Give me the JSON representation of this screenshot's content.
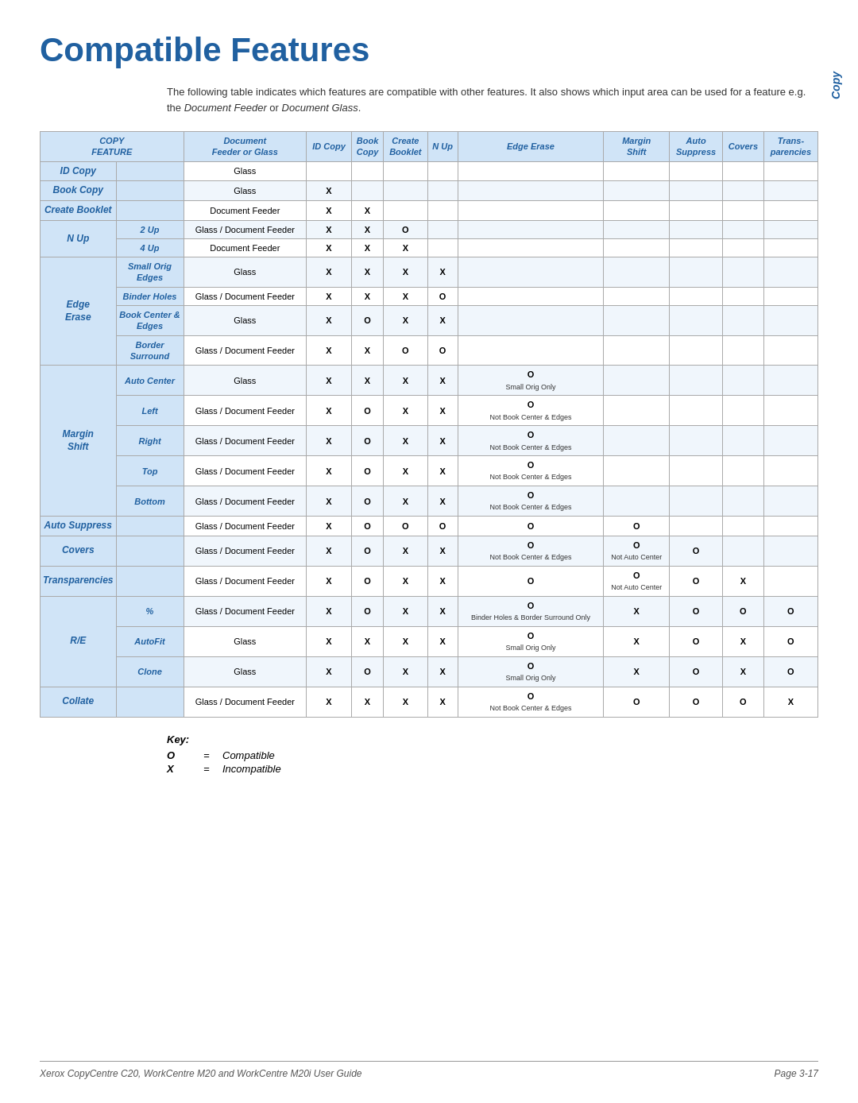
{
  "page": {
    "title": "Compatible Features",
    "side_label": "Copy",
    "intro": "The following table indicates which features are compatible with other features. It also shows which input area can be used for a feature e.g. the Document Feeder or Document Glass.",
    "footer_left": "Xerox CopyCentre C20, WorkCentre M20 and WorkCentre M20i User Guide",
    "footer_right": "Page 3-17"
  },
  "table": {
    "headers": [
      {
        "label": "COPY\nFEATURE",
        "sub": ""
      },
      {
        "label": "Document\nFeeder or Glass",
        "sub": ""
      },
      {
        "label": "ID Copy",
        "sub": ""
      },
      {
        "label": "Book\nCopy",
        "sub": ""
      },
      {
        "label": "Create\nBooklet",
        "sub": ""
      },
      {
        "label": "N Up",
        "sub": ""
      },
      {
        "label": "Edge Erase",
        "sub": ""
      },
      {
        "label": "Margin\nShift",
        "sub": ""
      },
      {
        "label": "Auto\nSuppress",
        "sub": ""
      },
      {
        "label": "Covers",
        "sub": ""
      },
      {
        "label": "Trans-\nparencies",
        "sub": ""
      }
    ],
    "rows": [
      {
        "feature": "ID Copy",
        "subfeature": "",
        "doc": "Glass",
        "id_copy": "",
        "book_copy": "",
        "create_booklet": "",
        "n_up": "",
        "edge_erase": "",
        "margin_shift": "",
        "auto_suppress": "",
        "covers": "",
        "transparencies": "",
        "alt": false
      },
      {
        "feature": "Book Copy",
        "subfeature": "",
        "doc": "Glass",
        "id_copy": "X",
        "book_copy": "",
        "create_booklet": "",
        "n_up": "",
        "edge_erase": "",
        "margin_shift": "",
        "auto_suppress": "",
        "covers": "",
        "transparencies": "",
        "alt": true
      },
      {
        "feature": "Create Booklet",
        "subfeature": "",
        "doc": "Document Feeder",
        "id_copy": "X",
        "book_copy": "X",
        "create_booklet": "",
        "n_up": "",
        "edge_erase": "",
        "margin_shift": "",
        "auto_suppress": "",
        "covers": "",
        "transparencies": "",
        "alt": false
      },
      {
        "feature": "N Up",
        "subfeature": "2 Up",
        "doc": "Glass / Document Feeder",
        "id_copy": "X",
        "book_copy": "X",
        "create_booklet": "O",
        "n_up": "",
        "edge_erase": "",
        "margin_shift": "",
        "auto_suppress": "",
        "covers": "",
        "transparencies": "",
        "alt": true
      },
      {
        "feature": "",
        "subfeature": "4 Up",
        "doc": "Document Feeder",
        "id_copy": "X",
        "book_copy": "X",
        "create_booklet": "X",
        "n_up": "",
        "edge_erase": "",
        "margin_shift": "",
        "auto_suppress": "",
        "covers": "",
        "transparencies": "",
        "alt": false
      },
      {
        "feature": "Edge\nErase",
        "subfeature": "Small Orig Edges",
        "doc": "Glass",
        "id_copy": "X",
        "book_copy": "X",
        "create_booklet": "X",
        "n_up": "X",
        "edge_erase": "",
        "margin_shift": "",
        "auto_suppress": "",
        "covers": "",
        "transparencies": "",
        "alt": true
      },
      {
        "feature": "",
        "subfeature": "Binder Holes",
        "doc": "Glass / Document Feeder",
        "id_copy": "X",
        "book_copy": "X",
        "create_booklet": "X",
        "n_up": "O",
        "edge_erase": "",
        "margin_shift": "",
        "auto_suppress": "",
        "covers": "",
        "transparencies": "",
        "alt": false
      },
      {
        "feature": "",
        "subfeature": "Book Center & Edges",
        "doc": "Glass",
        "id_copy": "X",
        "book_copy": "O",
        "create_booklet": "X",
        "n_up": "X",
        "edge_erase": "",
        "margin_shift": "",
        "auto_suppress": "",
        "covers": "",
        "transparencies": "",
        "alt": true
      },
      {
        "feature": "",
        "subfeature": "Border Surround",
        "doc": "Glass / Document Feeder",
        "id_copy": "X",
        "book_copy": "X",
        "create_booklet": "O",
        "n_up": "O",
        "edge_erase": "",
        "margin_shift": "",
        "auto_suppress": "",
        "covers": "",
        "transparencies": "",
        "alt": false
      },
      {
        "feature": "Margin\nShift",
        "subfeature": "Auto Center",
        "doc": "Glass",
        "id_copy": "X",
        "book_copy": "X",
        "create_booklet": "X",
        "n_up": "X",
        "edge_erase": "O\nSmall Orig Only",
        "margin_shift": "",
        "auto_suppress": "",
        "covers": "",
        "transparencies": "",
        "alt": true
      },
      {
        "feature": "",
        "subfeature": "Left",
        "doc": "Glass / Document Feeder",
        "id_copy": "X",
        "book_copy": "O",
        "create_booklet": "X",
        "n_up": "X",
        "edge_erase": "O\nNot Book Center & Edges",
        "margin_shift": "",
        "auto_suppress": "",
        "covers": "",
        "transparencies": "",
        "alt": false
      },
      {
        "feature": "",
        "subfeature": "Right",
        "doc": "Glass / Document Feeder",
        "id_copy": "X",
        "book_copy": "O",
        "create_booklet": "X",
        "n_up": "X",
        "edge_erase": "O\nNot Book Center & Edges",
        "margin_shift": "",
        "auto_suppress": "",
        "covers": "",
        "transparencies": "",
        "alt": true
      },
      {
        "feature": "",
        "subfeature": "Top",
        "doc": "Glass / Document Feeder",
        "id_copy": "X",
        "book_copy": "O",
        "create_booklet": "X",
        "n_up": "X",
        "edge_erase": "O\nNot Book Center & Edges",
        "margin_shift": "",
        "auto_suppress": "",
        "covers": "",
        "transparencies": "",
        "alt": false
      },
      {
        "feature": "",
        "subfeature": "Bottom",
        "doc": "Glass / Document Feeder",
        "id_copy": "X",
        "book_copy": "O",
        "create_booklet": "X",
        "n_up": "X",
        "edge_erase": "O\nNot Book Center & Edges",
        "margin_shift": "",
        "auto_suppress": "",
        "covers": "",
        "transparencies": "",
        "alt": true
      },
      {
        "feature": "Auto Suppress",
        "subfeature": "",
        "doc": "Glass / Document Feeder",
        "id_copy": "X",
        "book_copy": "O",
        "create_booklet": "O",
        "n_up": "O",
        "edge_erase": "O",
        "margin_shift": "O",
        "auto_suppress": "",
        "covers": "",
        "transparencies": "",
        "alt": false
      },
      {
        "feature": "Covers",
        "subfeature": "",
        "doc": "Glass / Document Feeder",
        "id_copy": "X",
        "book_copy": "O",
        "create_booklet": "X",
        "n_up": "X",
        "edge_erase": "O\nNot Book Center & Edges",
        "margin_shift": "O\nNot Auto Center",
        "auto_suppress": "O",
        "covers": "",
        "transparencies": "",
        "alt": true
      },
      {
        "feature": "Transparencies",
        "subfeature": "",
        "doc": "Glass / Document Feeder",
        "id_copy": "X",
        "book_copy": "O",
        "create_booklet": "X",
        "n_up": "X",
        "edge_erase": "O",
        "margin_shift": "O\nNot Auto Center",
        "auto_suppress": "O",
        "covers": "X",
        "transparencies": "",
        "alt": false
      },
      {
        "feature": "R/E",
        "subfeature": "%",
        "doc": "Glass / Document Feeder",
        "id_copy": "X",
        "book_copy": "O",
        "create_booklet": "X",
        "n_up": "X",
        "edge_erase": "O\nBinder Holes & Border Surround Only",
        "margin_shift": "X",
        "auto_suppress": "O",
        "covers": "O",
        "transparencies": "O",
        "alt": true
      },
      {
        "feature": "",
        "subfeature": "AutoFit",
        "doc": "Glass",
        "id_copy": "X",
        "book_copy": "X",
        "create_booklet": "X",
        "n_up": "X",
        "edge_erase": "O\nSmall Orig Only",
        "margin_shift": "X",
        "auto_suppress": "O",
        "covers": "X",
        "transparencies": "O",
        "alt": false
      },
      {
        "feature": "",
        "subfeature": "Clone",
        "doc": "Glass",
        "id_copy": "X",
        "book_copy": "O",
        "create_booklet": "X",
        "n_up": "X",
        "edge_erase": "O\nSmall Orig Only",
        "margin_shift": "X",
        "auto_suppress": "O",
        "covers": "X",
        "transparencies": "O",
        "alt": true
      },
      {
        "feature": "Collate",
        "subfeature": "",
        "doc": "Glass / Document Feeder",
        "id_copy": "X",
        "book_copy": "X",
        "create_booklet": "X",
        "n_up": "X",
        "edge_erase": "O\nNot Book Center & Edges",
        "margin_shift": "O",
        "auto_suppress": "O",
        "covers": "O",
        "transparencies": "X",
        "alt": false
      }
    ]
  },
  "key": {
    "title": "Key:",
    "items": [
      {
        "symbol": "O",
        "eq": "=",
        "desc": "Compatible"
      },
      {
        "symbol": "X",
        "eq": "=",
        "desc": "Incompatible"
      }
    ]
  }
}
